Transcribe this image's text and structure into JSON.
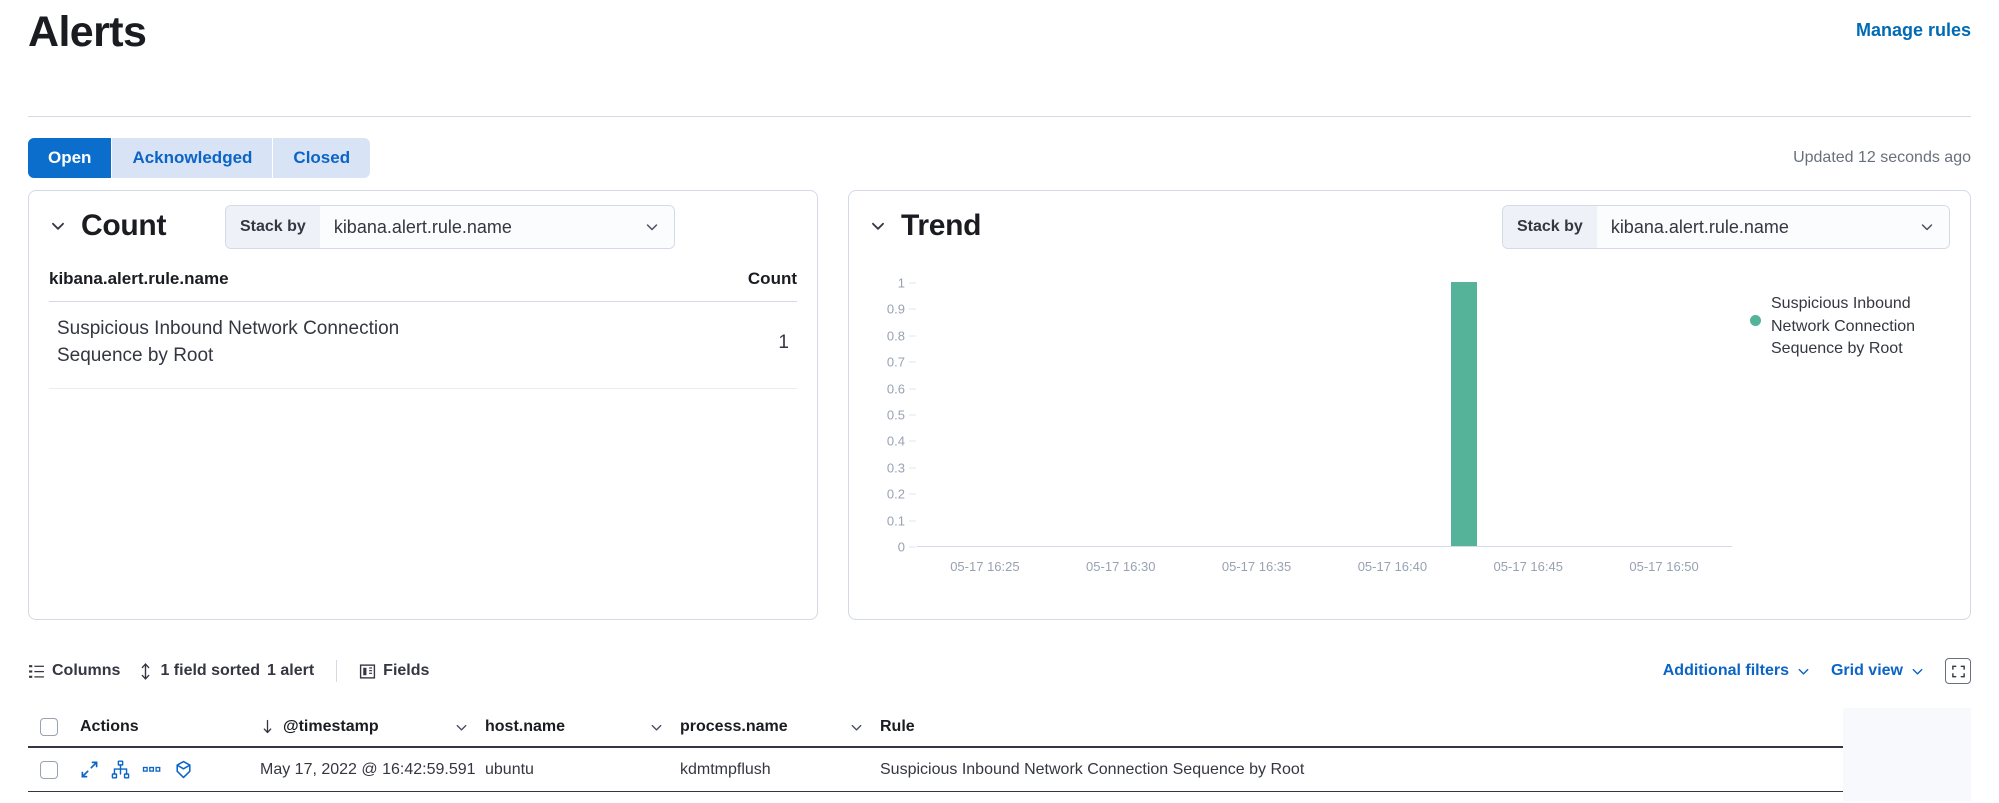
{
  "header": {
    "title": "Alerts",
    "manage_rules_label": "Manage rules"
  },
  "tabs": [
    {
      "label": "Open",
      "active": true
    },
    {
      "label": "Acknowledged",
      "active": false
    },
    {
      "label": "Closed",
      "active": false
    }
  ],
  "status": {
    "updated_text": "Updated 12 seconds ago"
  },
  "count_panel": {
    "title": "Count",
    "stack_by_label": "Stack by",
    "stack_by_value": "kibana.alert.rule.name",
    "column_field": "kibana.alert.rule.name",
    "column_count": "Count",
    "rows": [
      {
        "name": "Suspicious Inbound Network Connection Sequence by Root",
        "count": "1"
      }
    ]
  },
  "trend_panel": {
    "title": "Trend",
    "stack_by_label": "Stack by",
    "stack_by_value": "kibana.alert.rule.name",
    "legend": [
      {
        "label": "Suspicious Inbound Network Connection Sequence by Root",
        "color": "#54B399"
      }
    ]
  },
  "chart_data": {
    "type": "bar",
    "title": "Trend",
    "xlabel": "",
    "ylabel": "",
    "grid": false,
    "legend_position": "right",
    "ylim": [
      0,
      1
    ],
    "yticks": [
      "1",
      "0.9",
      "0.8",
      "0.7",
      "0.6",
      "0.5",
      "0.4",
      "0.3",
      "0.2",
      "0.1",
      "0"
    ],
    "xticks": [
      "05-17 16:25",
      "05-17 16:30",
      "05-17 16:35",
      "05-17 16:40",
      "05-17 16:45",
      "05-17 16:50"
    ],
    "series": [
      {
        "name": "Suspicious Inbound Network Connection Sequence by Root",
        "color": "#54B399",
        "categories": [
          "05-17 16:42"
        ],
        "values": [
          1
        ]
      }
    ]
  },
  "grid_toolbar": {
    "columns_label": "Columns",
    "sorted_label": "1 field sorted",
    "alert_count_label": "1 alert",
    "fields_label": "Fields",
    "additional_filters_label": "Additional filters",
    "grid_view_label": "Grid view"
  },
  "table": {
    "headers": {
      "actions": "Actions",
      "timestamp": "@timestamp",
      "host": "host.name",
      "process": "process.name",
      "rule": "Rule"
    },
    "rows": [
      {
        "timestamp": "May 17, 2022 @ 16:42:59.591",
        "host": "ubuntu",
        "process": "kdmtmpflush",
        "rule": "Suspicious Inbound Network Connection Sequence by Root"
      }
    ]
  },
  "colors": {
    "accent_blue": "#0B6ECC",
    "link_blue": "#0b64c6",
    "series_teal": "#54B399"
  }
}
